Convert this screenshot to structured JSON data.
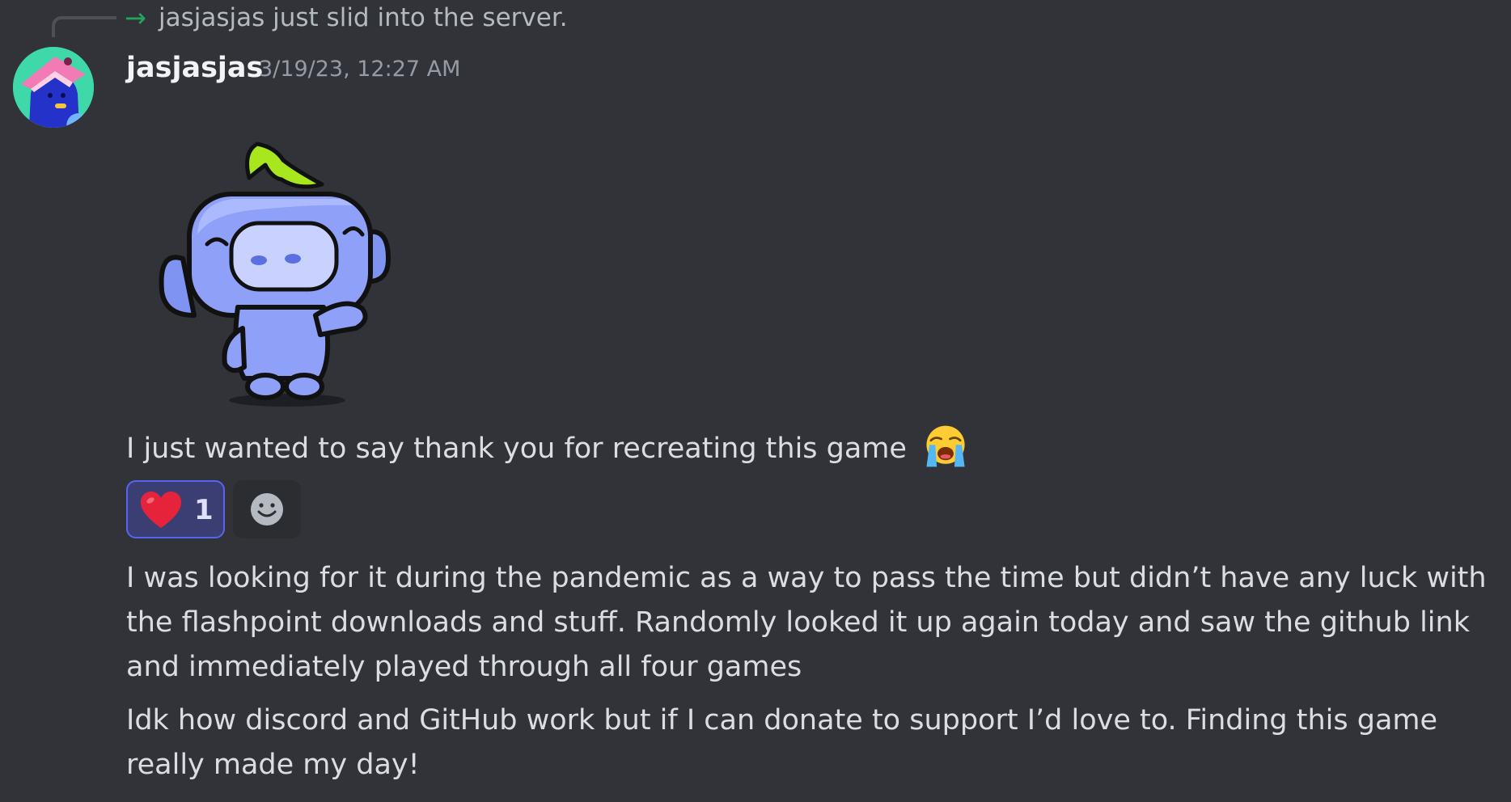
{
  "system_message": {
    "arrow": "→",
    "text": "jasjasjas just slid into the server."
  },
  "message": {
    "author": "jasjasjas",
    "timestamp": "3/19/23, 12:27 AM",
    "sticker": "wumpus-wave-sticker",
    "lines": [
      "I just wanted to say thank you for recreating this game",
      "I was looking for it during the pandemic as a way to pass the time but didn’t have any luck with the flashpoint downloads and stuff. Randomly looked it up again today and saw the github link and immediately played through all four games",
      "Idk how discord and GitHub work but if I can donate to support I’d love to. Finding this game really made my day!"
    ],
    "inline_emoji": "loudly-crying-face-icon"
  },
  "reactions": [
    {
      "emoji": "heart-icon",
      "count": "1",
      "active": true
    }
  ],
  "add_reaction_icon": "smiley-icon",
  "colors": {
    "background": "#313338",
    "join_arrow": "#23a55a",
    "reaction_active_border": "#5865f2",
    "heart": "#e5243b"
  }
}
